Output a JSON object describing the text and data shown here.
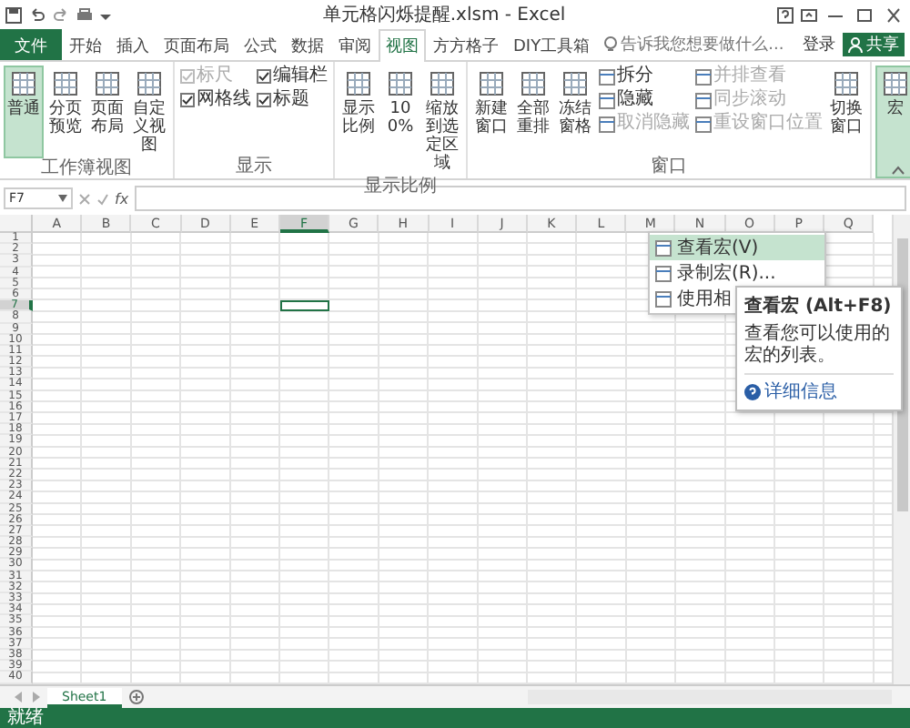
{
  "window": {
    "title": "单元格闪烁提醒.xlsm - Excel"
  },
  "tabs": [
    {
      "label": "文件",
      "kind": "file",
      "selected": false
    },
    {
      "label": "开始",
      "kind": "tab",
      "selected": false
    },
    {
      "label": "插入",
      "kind": "tab",
      "selected": false
    },
    {
      "label": "页面布局",
      "kind": "tab",
      "selected": false
    },
    {
      "label": "公式",
      "kind": "tab",
      "selected": false
    },
    {
      "label": "数据",
      "kind": "tab",
      "selected": false
    },
    {
      "label": "审阅",
      "kind": "tab",
      "selected": false
    },
    {
      "label": "视图",
      "kind": "tab",
      "selected": true
    },
    {
      "label": "方方格子",
      "kind": "tab",
      "selected": false
    },
    {
      "label": "DIY工具箱",
      "kind": "tab",
      "selected": false
    }
  ],
  "search": {
    "placeholder": "告诉我您想要做什么..."
  },
  "account": {
    "sign_in": "登录",
    "share": "共享"
  },
  "ribbon": {
    "groups": [
      {
        "label": "工作簿视图",
        "items": [
          {
            "kind": "large",
            "label": "普通",
            "selected": true
          },
          {
            "kind": "large",
            "label": "分页预览",
            "selected": false
          },
          {
            "kind": "large",
            "label": "页面布局",
            "selected": false
          },
          {
            "kind": "large",
            "label": "自定义视图",
            "selected": false
          }
        ]
      },
      {
        "label": "显示",
        "items": [
          {
            "kind": "stack",
            "entries": [
              {
                "kind": "check",
                "label": "标尺",
                "checked": true,
                "disabled": true
              },
              {
                "kind": "check",
                "label": "网格线",
                "checked": true,
                "disabled": false
              }
            ]
          },
          {
            "kind": "stack",
            "entries": [
              {
                "kind": "check",
                "label": "编辑栏",
                "checked": true,
                "disabled": false
              },
              {
                "kind": "check",
                "label": "标题",
                "checked": true,
                "disabled": false
              }
            ]
          }
        ]
      },
      {
        "label": "显示比例",
        "items": [
          {
            "kind": "large",
            "label": "显示比例",
            "selected": false
          },
          {
            "kind": "large",
            "label": "100%",
            "selected": false
          },
          {
            "kind": "large",
            "label": "缩放到选定区域",
            "selected": false
          }
        ]
      },
      {
        "label": "窗口",
        "items": [
          {
            "kind": "large",
            "label": "新建窗口",
            "selected": false
          },
          {
            "kind": "large",
            "label": "全部重排",
            "selected": false
          },
          {
            "kind": "large",
            "label": "冻结窗格",
            "selected": false
          },
          {
            "kind": "stack",
            "entries": [
              {
                "kind": "small",
                "label": "拆分",
                "disabled": false
              },
              {
                "kind": "small",
                "label": "隐藏",
                "disabled": false
              },
              {
                "kind": "small",
                "label": "取消隐藏",
                "disabled": true
              }
            ]
          },
          {
            "kind": "stack",
            "entries": [
              {
                "kind": "small",
                "label": "并排查看",
                "disabled": true
              },
              {
                "kind": "small",
                "label": "同步滚动",
                "disabled": true
              },
              {
                "kind": "small",
                "label": "重设窗口位置",
                "disabled": true
              }
            ]
          },
          {
            "kind": "large",
            "label": "切换窗口",
            "selected": false
          }
        ]
      },
      {
        "items": [
          {
            "kind": "large",
            "label": "宏",
            "selected": true
          }
        ]
      }
    ]
  },
  "macro_menu": {
    "items": [
      {
        "label": "查看宏(V)",
        "selected": true
      },
      {
        "label": "录制宏(R)...",
        "selected": false
      },
      {
        "label": "使用相",
        "selected": false
      }
    ]
  },
  "tooltip": {
    "title": "查看宏 (Alt+F8)",
    "body": "查看您可以使用的宏的列表。",
    "link": "详细信息"
  },
  "formula_bar": {
    "name_box": "F7",
    "function_label": "fx"
  },
  "columns": [
    {
      "label": "A",
      "selected": false
    },
    {
      "label": "B",
      "selected": false
    },
    {
      "label": "C",
      "selected": false
    },
    {
      "label": "D",
      "selected": false
    },
    {
      "label": "E",
      "selected": false
    },
    {
      "label": "F",
      "selected": true
    },
    {
      "label": "G",
      "selected": false
    },
    {
      "label": "H",
      "selected": false
    },
    {
      "label": "I",
      "selected": false
    },
    {
      "label": "J",
      "selected": false
    },
    {
      "label": "K",
      "selected": false
    },
    {
      "label": "L",
      "selected": false
    },
    {
      "label": "M",
      "selected": false
    },
    {
      "label": "N",
      "selected": false
    },
    {
      "label": "O",
      "selected": false
    },
    {
      "label": "P",
      "selected": false
    },
    {
      "label": "Q",
      "selected": false
    }
  ],
  "rows": [
    {
      "label": "1",
      "selected": false
    },
    {
      "label": "2",
      "selected": false
    },
    {
      "label": "3",
      "selected": false
    },
    {
      "label": "4",
      "selected": false
    },
    {
      "label": "5",
      "selected": false
    },
    {
      "label": "6",
      "selected": false
    },
    {
      "label": "7",
      "selected": true
    },
    {
      "label": "8",
      "selected": false
    },
    {
      "label": "9",
      "selected": false
    },
    {
      "label": "10",
      "selected": false
    },
    {
      "label": "11",
      "selected": false
    },
    {
      "label": "12",
      "selected": false
    },
    {
      "label": "13",
      "selected": false
    },
    {
      "label": "14",
      "selected": false
    },
    {
      "label": "15",
      "selected": false
    },
    {
      "label": "16",
      "selected": false
    },
    {
      "label": "17",
      "selected": false
    },
    {
      "label": "18",
      "selected": false
    },
    {
      "label": "19",
      "selected": false
    },
    {
      "label": "20",
      "selected": false
    },
    {
      "label": "21",
      "selected": false
    },
    {
      "label": "22",
      "selected": false
    },
    {
      "label": "23",
      "selected": false
    },
    {
      "label": "24",
      "selected": false
    },
    {
      "label": "25",
      "selected": false
    },
    {
      "label": "26",
      "selected": false
    },
    {
      "label": "27",
      "selected": false
    },
    {
      "label": "28",
      "selected": false
    },
    {
      "label": "29",
      "selected": false
    },
    {
      "label": "30",
      "selected": false
    },
    {
      "label": "31",
      "selected": false
    },
    {
      "label": "32",
      "selected": false
    },
    {
      "label": "33",
      "selected": false
    },
    {
      "label": "34",
      "selected": false
    },
    {
      "label": "35",
      "selected": false
    },
    {
      "label": "36",
      "selected": false
    },
    {
      "label": "37",
      "selected": false
    },
    {
      "label": "38",
      "selected": false
    },
    {
      "label": "39",
      "selected": false
    },
    {
      "label": "40",
      "selected": false
    }
  ],
  "sheets": [
    {
      "label": "Sheet1",
      "selected": true
    }
  ],
  "status_bar": {
    "text": "就绪"
  }
}
